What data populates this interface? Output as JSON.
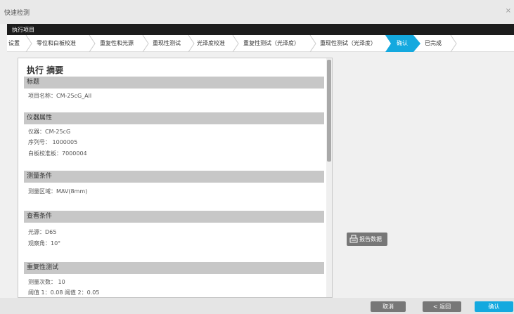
{
  "window": {
    "title": "快速检测",
    "close_glyph": "×",
    "bar_label": "执行项目"
  },
  "steps": [
    {
      "label": "设置"
    },
    {
      "label": "零位和白板校准"
    },
    {
      "label": "重复性和光源"
    },
    {
      "label": "重现性测试"
    },
    {
      "label": "光泽度校准"
    },
    {
      "label": "重复性测试（光泽度）"
    },
    {
      "label": "重现性测试（光泽度）"
    },
    {
      "label": "确认",
      "active": true
    },
    {
      "label": "已完成"
    }
  ],
  "summary": {
    "title": "执行 摘要",
    "sections": [
      {
        "heading": "标题",
        "rows": [
          "项目名称：CM-25cG_All"
        ]
      },
      {
        "heading": "仪器属性",
        "rows": [
          "仪器：CM-25cG",
          "序列号： 1000005",
          "白板校准板：7000004"
        ]
      },
      {
        "heading": "测量条件",
        "rows": [
          "测量区域：MAV(8mm)"
        ]
      },
      {
        "heading": "查看条件",
        "rows": [
          "光源：D65",
          "观察角：10°"
        ]
      },
      {
        "heading": "重复性测试",
        "rows": [
          "测量次数： 10",
          "阈值 1：0.08  阈值 2：0.05"
        ]
      }
    ]
  },
  "report_button": {
    "label": "报告数据",
    "icon": "report-print-icon"
  },
  "footer": {
    "cancel_label": "取消",
    "back_label": "< 返回",
    "confirm_label": "确认"
  },
  "colors": {
    "accent": "#14a9df",
    "dark_bar": "#1c1c1c",
    "section_bg": "#c7c7c7",
    "button_gray": "#777777"
  }
}
